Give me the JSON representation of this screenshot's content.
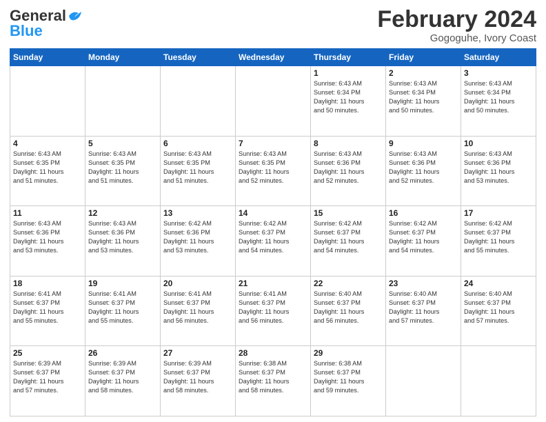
{
  "header": {
    "logo_general": "General",
    "logo_blue": "Blue",
    "month_year": "February 2024",
    "location": "Gogoguhe, Ivory Coast"
  },
  "days_of_week": [
    "Sunday",
    "Monday",
    "Tuesday",
    "Wednesday",
    "Thursday",
    "Friday",
    "Saturday"
  ],
  "weeks": [
    {
      "shade": false,
      "days": [
        {
          "num": "",
          "info": ""
        },
        {
          "num": "",
          "info": ""
        },
        {
          "num": "",
          "info": ""
        },
        {
          "num": "",
          "info": ""
        },
        {
          "num": "1",
          "info": "Sunrise: 6:43 AM\nSunset: 6:34 PM\nDaylight: 11 hours\nand 50 minutes."
        },
        {
          "num": "2",
          "info": "Sunrise: 6:43 AM\nSunset: 6:34 PM\nDaylight: 11 hours\nand 50 minutes."
        },
        {
          "num": "3",
          "info": "Sunrise: 6:43 AM\nSunset: 6:34 PM\nDaylight: 11 hours\nand 50 minutes."
        }
      ]
    },
    {
      "shade": true,
      "days": [
        {
          "num": "4",
          "info": "Sunrise: 6:43 AM\nSunset: 6:35 PM\nDaylight: 11 hours\nand 51 minutes."
        },
        {
          "num": "5",
          "info": "Sunrise: 6:43 AM\nSunset: 6:35 PM\nDaylight: 11 hours\nand 51 minutes."
        },
        {
          "num": "6",
          "info": "Sunrise: 6:43 AM\nSunset: 6:35 PM\nDaylight: 11 hours\nand 51 minutes."
        },
        {
          "num": "7",
          "info": "Sunrise: 6:43 AM\nSunset: 6:35 PM\nDaylight: 11 hours\nand 52 minutes."
        },
        {
          "num": "8",
          "info": "Sunrise: 6:43 AM\nSunset: 6:36 PM\nDaylight: 11 hours\nand 52 minutes."
        },
        {
          "num": "9",
          "info": "Sunrise: 6:43 AM\nSunset: 6:36 PM\nDaylight: 11 hours\nand 52 minutes."
        },
        {
          "num": "10",
          "info": "Sunrise: 6:43 AM\nSunset: 6:36 PM\nDaylight: 11 hours\nand 53 minutes."
        }
      ]
    },
    {
      "shade": false,
      "days": [
        {
          "num": "11",
          "info": "Sunrise: 6:43 AM\nSunset: 6:36 PM\nDaylight: 11 hours\nand 53 minutes."
        },
        {
          "num": "12",
          "info": "Sunrise: 6:43 AM\nSunset: 6:36 PM\nDaylight: 11 hours\nand 53 minutes."
        },
        {
          "num": "13",
          "info": "Sunrise: 6:42 AM\nSunset: 6:36 PM\nDaylight: 11 hours\nand 53 minutes."
        },
        {
          "num": "14",
          "info": "Sunrise: 6:42 AM\nSunset: 6:37 PM\nDaylight: 11 hours\nand 54 minutes."
        },
        {
          "num": "15",
          "info": "Sunrise: 6:42 AM\nSunset: 6:37 PM\nDaylight: 11 hours\nand 54 minutes."
        },
        {
          "num": "16",
          "info": "Sunrise: 6:42 AM\nSunset: 6:37 PM\nDaylight: 11 hours\nand 54 minutes."
        },
        {
          "num": "17",
          "info": "Sunrise: 6:42 AM\nSunset: 6:37 PM\nDaylight: 11 hours\nand 55 minutes."
        }
      ]
    },
    {
      "shade": true,
      "days": [
        {
          "num": "18",
          "info": "Sunrise: 6:41 AM\nSunset: 6:37 PM\nDaylight: 11 hours\nand 55 minutes."
        },
        {
          "num": "19",
          "info": "Sunrise: 6:41 AM\nSunset: 6:37 PM\nDaylight: 11 hours\nand 55 minutes."
        },
        {
          "num": "20",
          "info": "Sunrise: 6:41 AM\nSunset: 6:37 PM\nDaylight: 11 hours\nand 56 minutes."
        },
        {
          "num": "21",
          "info": "Sunrise: 6:41 AM\nSunset: 6:37 PM\nDaylight: 11 hours\nand 56 minutes."
        },
        {
          "num": "22",
          "info": "Sunrise: 6:40 AM\nSunset: 6:37 PM\nDaylight: 11 hours\nand 56 minutes."
        },
        {
          "num": "23",
          "info": "Sunrise: 6:40 AM\nSunset: 6:37 PM\nDaylight: 11 hours\nand 57 minutes."
        },
        {
          "num": "24",
          "info": "Sunrise: 6:40 AM\nSunset: 6:37 PM\nDaylight: 11 hours\nand 57 minutes."
        }
      ]
    },
    {
      "shade": false,
      "days": [
        {
          "num": "25",
          "info": "Sunrise: 6:39 AM\nSunset: 6:37 PM\nDaylight: 11 hours\nand 57 minutes."
        },
        {
          "num": "26",
          "info": "Sunrise: 6:39 AM\nSunset: 6:37 PM\nDaylight: 11 hours\nand 58 minutes."
        },
        {
          "num": "27",
          "info": "Sunrise: 6:39 AM\nSunset: 6:37 PM\nDaylight: 11 hours\nand 58 minutes."
        },
        {
          "num": "28",
          "info": "Sunrise: 6:38 AM\nSunset: 6:37 PM\nDaylight: 11 hours\nand 58 minutes."
        },
        {
          "num": "29",
          "info": "Sunrise: 6:38 AM\nSunset: 6:37 PM\nDaylight: 11 hours\nand 59 minutes."
        },
        {
          "num": "",
          "info": ""
        },
        {
          "num": "",
          "info": ""
        }
      ]
    }
  ]
}
